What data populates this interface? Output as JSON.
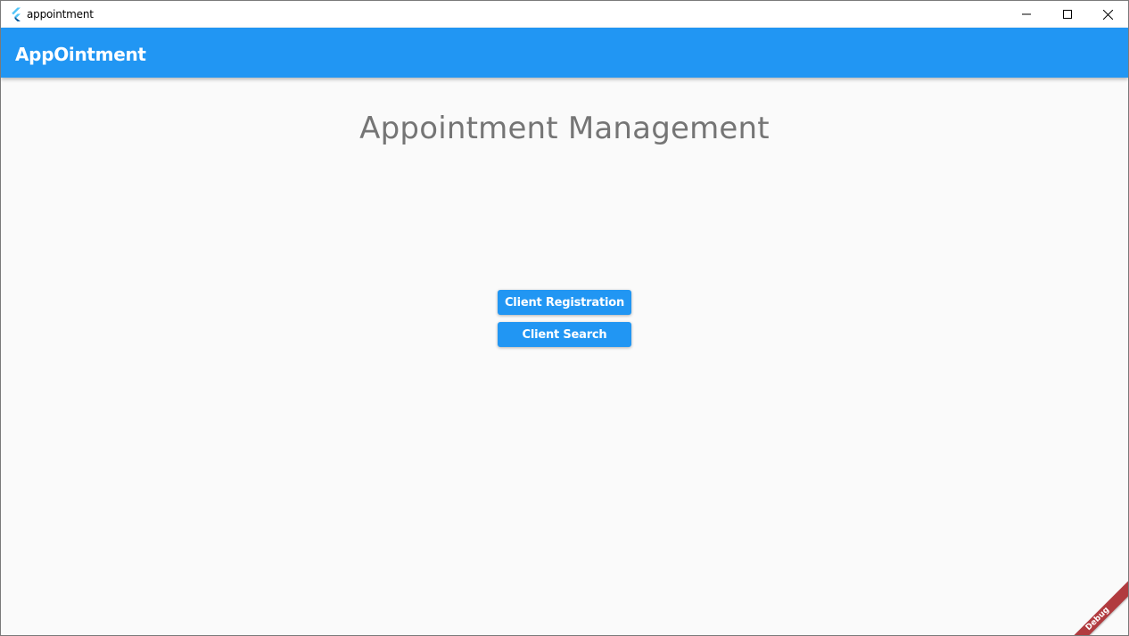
{
  "window": {
    "title": "appointment",
    "controls": {
      "minimize_icon": "minimize-icon",
      "maximize_icon": "maximize-icon",
      "close_icon": "close-icon"
    }
  },
  "appbar": {
    "title": "AppOintment",
    "color": "#2196f3"
  },
  "main": {
    "heading": "Appointment Management",
    "buttons": [
      {
        "label": "Client Registration"
      },
      {
        "label": "Client Search"
      }
    ],
    "button_color": "#2196f3"
  },
  "debug_banner": {
    "label": "Debug",
    "color": "#b13b3f"
  },
  "colors": {
    "logo_light": "#54c5f8",
    "logo_dark": "#01579b",
    "background": "#fafafa",
    "heading_text": "#757575"
  }
}
